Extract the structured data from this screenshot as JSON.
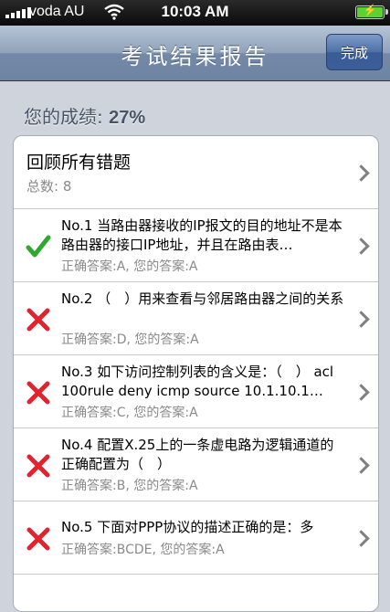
{
  "status_bar": {
    "carrier": "voda AU",
    "time": "10:03 AM",
    "battery_icon": "battery-charging-icon",
    "wifi_icon": "wifi-icon"
  },
  "nav": {
    "title": "考试结果报告",
    "done_label": "完成"
  },
  "score": {
    "label": "您的成绩: ",
    "value": "27%"
  },
  "review": {
    "title": "回顾所有错题",
    "count_label": "总数: 8"
  },
  "questions": [
    {
      "status": "correct",
      "icon": "check-icon",
      "text": "No.1 当路由器接收的IP报文的目的地址不是本路由器的接口IP地址，并且在路由表…",
      "answer": "正确答案:A, 您的答案:A"
    },
    {
      "status": "wrong",
      "icon": "cross-icon",
      "text": "No.2 （　）用来查看与邻居路由器之间的关系",
      "answer": "正确答案:D, 您的答案:A"
    },
    {
      "status": "wrong",
      "icon": "cross-icon",
      "text": "No.3 如下访问控制列表的含义是：（　） acl 100rule deny icmp source 10.1.10.1…",
      "answer": "正确答案:C, 您的答案:A"
    },
    {
      "status": "wrong",
      "icon": "cross-icon",
      "text": "No.4 配置X.25上的一条虚电路为逻辑通道的正确配置为（　）",
      "answer": "正确答案:B, 您的答案:A"
    },
    {
      "status": "wrong",
      "icon": "cross-icon",
      "text": "No.5 下面对PPP协议的描述正确的是：多",
      "answer": "正确答案:BCDE, 您的答案:A"
    }
  ],
  "colors": {
    "correct": "#2ea82e",
    "wrong": "#e0242f",
    "nav_accent": "#6d84a3"
  }
}
